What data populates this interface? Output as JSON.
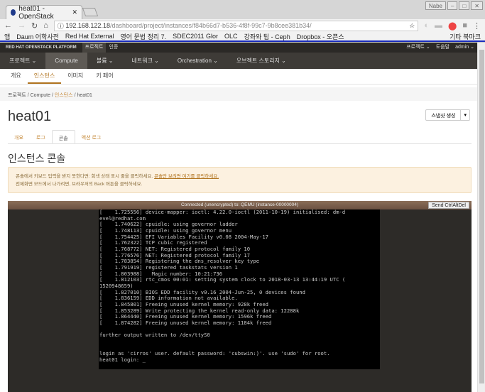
{
  "browser": {
    "tab_title": "heat01 - OpenStack",
    "window_label": "Nabe",
    "url_host": "192.168.122.18",
    "url_path": "/dashboard/project/instances/f84b66d7-b536-4f8f-99c7-9b8cee381b34/",
    "bookmarks": [
      "앱",
      "Daum 어학사전",
      "Red Hat External",
      "영어 문법 정리 7.",
      "SDEC2011 Glor",
      "OLC",
      "강좌와 팁 - Ceph",
      "Dropbox - 오픈스",
      "기타 북마크"
    ]
  },
  "topbar": {
    "brand": "RED HAT OPENSTACK PLATFORM",
    "tabs": [
      "프로젝트",
      "인증"
    ],
    "right": [
      "프로젝트 ⌄",
      "도움말",
      "admin ⌄"
    ]
  },
  "nav": [
    "프로젝트 ⌄",
    "Compute",
    "볼륨 ⌄",
    "네트워크 ⌄",
    "Orchestration ⌄",
    "오브젝트 스토리지 ⌄"
  ],
  "subnav": [
    "개요",
    "인스턴스",
    "이미지",
    "키 페어"
  ],
  "breadcrumb": {
    "a": "프로젝트",
    "b": "Compute",
    "c": "인스턴스",
    "d": "heat01"
  },
  "title": "heat01",
  "snapshot_button": "스냅샷 생성",
  "tabs": [
    "개요",
    "로그",
    "콘솔",
    "액션 로그"
  ],
  "heading": "인스턴스 콘솔",
  "alert": {
    "line1": "콘솔에서 키보드 입력을 받지 못한다면: 회색 상태 표시 줄을 클릭하세요. ",
    "link": "콘솔만 보려면 여기를 클릭하세요.",
    "line2": "전체화면 모드에서 나가려면, 브라우저의 Back 버튼을 클릭하세요."
  },
  "console": {
    "status": "Connected (unencrypted) to: QEMU (instance-00000004)",
    "send_button": "Send CtrlAltDel",
    "output": "[    1.725556] device-mapper: ioctl: 4.22.0-ioctl (2011-10-19) initialised: dm-d\nevel@redhat.com\n[    1.740622] cpuidle: using governor ladder\n[    1.748113] cpuidle: using governor menu\n[    1.754425] EFI Variables Facility v0.08 2004-May-17\n[    1.762322] TCP cubic registered\n[    1.768772] NET: Registered protocol family 10\n[    1.776576] NET: Registered protocol family 17\n[    1.783854] Registering the dns_resolver key type\n[    1.791919] registered taskstats version 1\n[    1.803988]   Magic number: 10:21:736\n[    1.812103] rtc_cmos 00:01: setting system clock to 2018-03-13 13:44:19 UTC (\n1520948659)\n[    1.827010] BIOS EDD facility v0.16 2004-Jun-25, 0 devices found\n[    1.836159] EDD information not available.\n[    1.845801] Freeing unused kernel memory: 928k freed\n[    1.853289] Write protecting the kernel read-only data: 12288k\n[    1.864440] Freeing unused kernel memory: 1596k freed\n[    1.874282] Freeing unused kernel memory: 1184k freed\n\nfurther output written to /dev/ttyS0\n\n\nlogin as 'cirros' user. default password: 'cubswin:)'. use 'sudo' for root.\nheat01 login: _"
  }
}
